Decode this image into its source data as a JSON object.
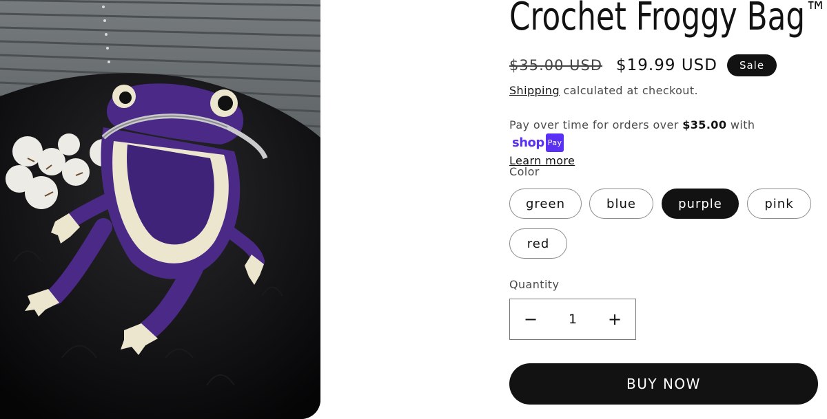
{
  "product": {
    "title": "Crochet Froggy Bag",
    "trademark": "™",
    "image_icon": "crochet-frog-bag-photo"
  },
  "pricing": {
    "regular_price": "$35.00 USD",
    "sale_price": "$19.99 USD",
    "sale_badge": "Sale"
  },
  "shipping": {
    "link_text": "Shipping",
    "text": " calculated at checkout."
  },
  "installments": {
    "text_before": "Pay over time for orders over ",
    "threshold": "$35.00",
    "text_after": " with ",
    "brand_word": "shop",
    "brand_pay": "Pay",
    "learn_more": "Learn more"
  },
  "color": {
    "label": "Color",
    "options": [
      "green",
      "blue",
      "purple",
      "pink",
      "red"
    ],
    "selected": "purple"
  },
  "quantity": {
    "label": "Quantity",
    "value": "1",
    "decrement": "−",
    "increment": "+"
  },
  "cta": {
    "buy_now": "BUY NOW"
  },
  "colors": {
    "primary": "#121212",
    "shop_pay": "#5a31f4",
    "frog_purple": "#4a2a86",
    "frog_cream": "#ece6cf"
  }
}
